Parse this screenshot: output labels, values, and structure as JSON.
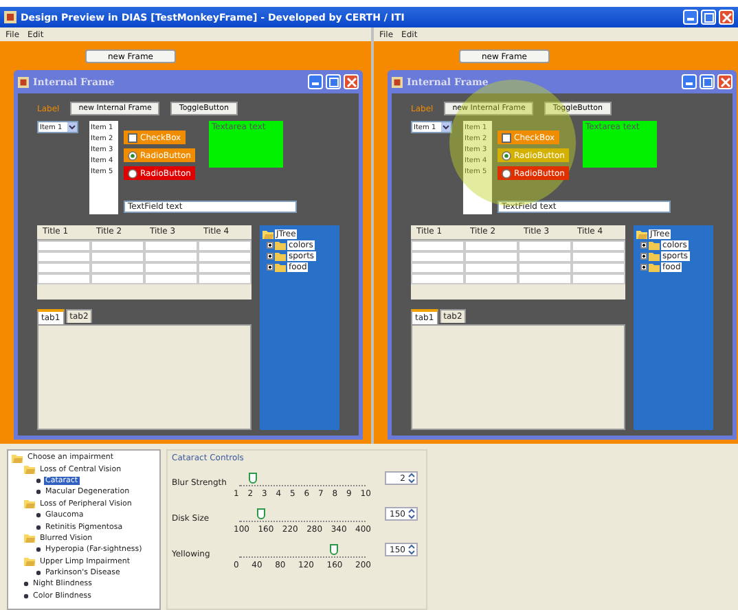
{
  "window": {
    "title": "Design Preview in DIAS [TestMonkeyFrame] - Developed by CERTH / ITI"
  },
  "previews": [
    {
      "menu": [
        "File",
        "Edit"
      ],
      "new_frame_button": "new Frame",
      "magnifier_overlay": false,
      "internal_frame": {
        "title": "Internal Frame",
        "label": "Label",
        "buttons": [
          "new Internal Frame",
          "ToggleButton"
        ],
        "combo": "Item 1",
        "list": [
          "Item 1",
          "Item 2",
          "Item 3",
          "Item 4",
          "Item 5"
        ],
        "checkbox": {
          "label": "CheckBox",
          "checked": false
        },
        "radios": [
          {
            "label": "RadioButton",
            "selected": true,
            "color": "#f08c00"
          },
          {
            "label": "RadioButton",
            "selected": false,
            "color": "#e00000"
          }
        ],
        "text_area": "Textarea text",
        "text_field": "TextField text",
        "table": {
          "columns": [
            "Title 1",
            "Title 2",
            "Title 3",
            "Title 4"
          ]
        },
        "tree": {
          "label": "JTree",
          "expanded": true,
          "children": [
            {
              "label": "colors",
              "expanded": false
            },
            {
              "label": "sports",
              "expanded": false
            },
            {
              "label": "food",
              "expanded": false
            }
          ]
        },
        "tabs": [
          {
            "label": "tab1",
            "selected": true
          },
          {
            "label": "tab2",
            "selected": false
          }
        ]
      }
    },
    {
      "menu": [
        "File",
        "Edit"
      ],
      "new_frame_button": "new Frame",
      "magnifier_overlay": true,
      "internal_frame": {
        "title": "Internal Frame",
        "label": "Label",
        "buttons": [
          "new Internal Frame",
          "ToggleButton"
        ],
        "combo": "Item 1",
        "list": [
          "Item 1",
          "Item 2",
          "Item 3",
          "Item 4",
          "Item 5"
        ],
        "checkbox": {
          "label": "CheckBox",
          "checked": false
        },
        "radios": [
          {
            "label": "RadioButton",
            "selected": true,
            "color": "#d4b000"
          },
          {
            "label": "RadioButton",
            "selected": false,
            "color": "#e03000"
          }
        ],
        "text_area": "Textarea text",
        "text_field": "TextField text",
        "table": {
          "columns": [
            "Title 1",
            "Title 2",
            "Title 3",
            "Title 4"
          ]
        },
        "tree": {
          "label": "JTree",
          "expanded": true,
          "children": [
            {
              "label": "colors",
              "expanded": false
            },
            {
              "label": "sports",
              "expanded": false
            },
            {
              "label": "food",
              "expanded": false
            }
          ]
        },
        "tabs": [
          {
            "label": "tab1",
            "selected": true
          },
          {
            "label": "tab2",
            "selected": false
          }
        ]
      }
    }
  ],
  "impairments": [
    {
      "label": "Choose an impairment",
      "selected": false,
      "expanded": true,
      "children": [
        {
          "label": "Loss of Central Vision",
          "selected": false,
          "expanded": true,
          "children": [
            {
              "label": "Cataract",
              "selected": true
            },
            {
              "label": "Macular Degeneration",
              "selected": false
            }
          ]
        },
        {
          "label": "Loss of Peripheral Vision",
          "selected": false,
          "expanded": true,
          "children": [
            {
              "label": "Glaucoma",
              "selected": false
            },
            {
              "label": "Retinitis Pigmentosa",
              "selected": false
            }
          ]
        },
        {
          "label": "Blurred Vision",
          "selected": false,
          "expanded": true,
          "children": [
            {
              "label": "Hyperopia (Far-sightness)",
              "selected": false
            }
          ]
        },
        {
          "label": "Upper Limp Impairment",
          "selected": false,
          "expanded": true,
          "children": [
            {
              "label": "Parkinson's Disease",
              "selected": false
            }
          ]
        },
        {
          "label": "Night Blindness",
          "selected": false
        },
        {
          "label": "Color Blindness",
          "selected": false
        }
      ]
    }
  ],
  "cataract_controls": {
    "title": "Cataract Controls",
    "sliders": [
      {
        "label": "Blur Strength",
        "level": 0.11,
        "ticks": [
          "1",
          "2",
          "3",
          "4",
          "5",
          "6",
          "7",
          "8",
          "9",
          "10"
        ],
        "value": "2"
      },
      {
        "label": "Disk Size",
        "level": 0.17,
        "ticks": [
          "100",
          "160",
          "220",
          "280",
          "340",
          "400"
        ],
        "value": "150"
      },
      {
        "label": "Yellowing",
        "level": 0.75,
        "ticks": [
          "0",
          "40",
          "80",
          "120",
          "160",
          "200"
        ],
        "value": "150"
      }
    ]
  }
}
